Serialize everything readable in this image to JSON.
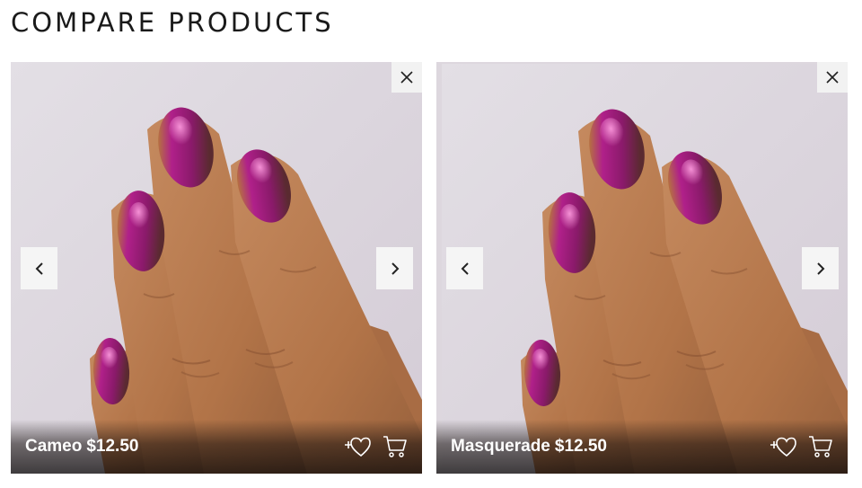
{
  "page": {
    "title": "COMPARE PRODUCTS"
  },
  "products": [
    {
      "name": "Cameo",
      "price": "$12.50"
    },
    {
      "name": "Masquerade",
      "price": "$12.50"
    }
  ],
  "colors": {
    "background": "#ffffff",
    "title": "#1a1a1a",
    "photo_background": "#ddd7de",
    "skin": "#b5784f",
    "polish_magenta": "#b0208a",
    "polish_gold": "#b89a1c",
    "control_background": "#f5f5f5"
  },
  "icons": {
    "remove": "close-icon",
    "previous": "chevron-left-icon",
    "next": "chevron-right-icon",
    "wishlist": "heart-plus-icon",
    "cart": "cart-icon"
  }
}
